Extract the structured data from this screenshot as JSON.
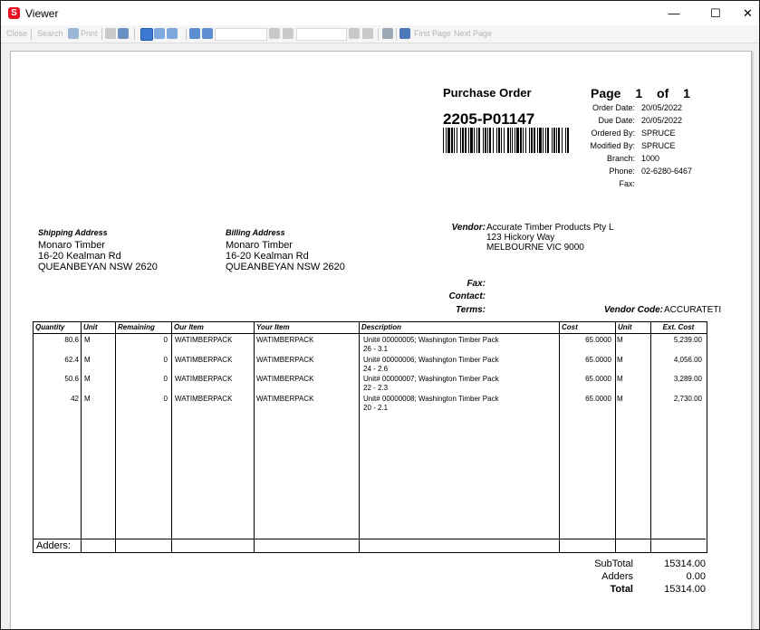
{
  "window": {
    "title": "Viewer",
    "app_icon_letter": "S",
    "min_glyph": "—",
    "max_glyph": "☐",
    "close_glyph": "✕"
  },
  "toolbar": {
    "items": [
      "Close",
      "Search",
      "Print",
      "First Page",
      "Next Page"
    ]
  },
  "document": {
    "heading": "Purchase Order",
    "po_number": "2205-P01147",
    "page_word": "Page",
    "page_current": "1",
    "page_of": "of",
    "page_total": "1",
    "info": [
      {
        "label": "Order Date:",
        "value": "20/05/2022"
      },
      {
        "label": "Due Date:",
        "value": "20/05/2022"
      },
      {
        "label": "Ordered By:",
        "value": "SPRUCE"
      },
      {
        "label": "Modified By:",
        "value": "SPRUCE"
      },
      {
        "label": "Branch:",
        "value": "1000"
      },
      {
        "label": "Phone:",
        "value": "02-6280-6467"
      },
      {
        "label": "Fax:",
        "value": ""
      }
    ],
    "shipping": {
      "title": "Shipping Address",
      "lines": [
        "Monaro Timber",
        "16-20 Kealman Rd",
        "QUEANBEYAN NSW 2620"
      ]
    },
    "billing": {
      "title": "Billing Address",
      "lines": [
        "Monaro Timber",
        "16-20 Kealman Rd",
        "QUEANBEYAN NSW 2620"
      ]
    },
    "vendor": {
      "label": "Vendor:",
      "lines": [
        "Accurate Timber Products Pty L",
        "123 Hickory Way",
        "MELBOURNE VIC 9000"
      ],
      "fax_label": "Fax:",
      "contact_label": "Contact:",
      "terms_label": "Terms:",
      "code_label": "Vendor Code:",
      "code_value": "ACCURATETI"
    },
    "table": {
      "headers": [
        "Quantity",
        "Unit",
        "Remaining",
        "Our Item",
        "Your Item",
        "Description",
        "Cost",
        "Unit",
        "Ext. Cost"
      ],
      "rows": [
        {
          "qty": "80.6",
          "unit": "M",
          "remaining": "0",
          "our_item": "WATIMBERPACK",
          "your_item": "WATIMBERPACK",
          "desc1": "Unit# 00000005; Washington Timber Pack",
          "desc2": "26 - 3.1",
          "cost": "65.0000",
          "unit2": "M",
          "ext": "5,239.00"
        },
        {
          "qty": "62.4",
          "unit": "M",
          "remaining": "0",
          "our_item": "WATIMBERPACK",
          "your_item": "WATIMBERPACK",
          "desc1": "Unit# 00000006; Washington Timber Pack",
          "desc2": "24 - 2.6",
          "cost": "65.0000",
          "unit2": "M",
          "ext": "4,056.00"
        },
        {
          "qty": "50.6",
          "unit": "M",
          "remaining": "0",
          "our_item": "WATIMBERPACK",
          "your_item": "WATIMBERPACK",
          "desc1": "Unit# 00000007; Washington Timber Pack",
          "desc2": "22 - 2.3",
          "cost": "65.0000",
          "unit2": "M",
          "ext": "3,289.00"
        },
        {
          "qty": "42",
          "unit": "M",
          "remaining": "0",
          "our_item": "WATIMBERPACK",
          "your_item": "WATIMBERPACK",
          "desc1": "Unit# 00000008; Washington Timber Pack",
          "desc2": "20 - 2.1",
          "cost": "65.0000",
          "unit2": "M",
          "ext": "2,730.00"
        }
      ],
      "adders_label": "Adders:"
    },
    "totals": [
      {
        "label": "SubTotal",
        "value": "15314.00",
        "bold": false
      },
      {
        "label": "Adders",
        "value": "0.00",
        "bold": false
      },
      {
        "label": "Total",
        "value": "15314.00",
        "bold": true
      }
    ]
  }
}
